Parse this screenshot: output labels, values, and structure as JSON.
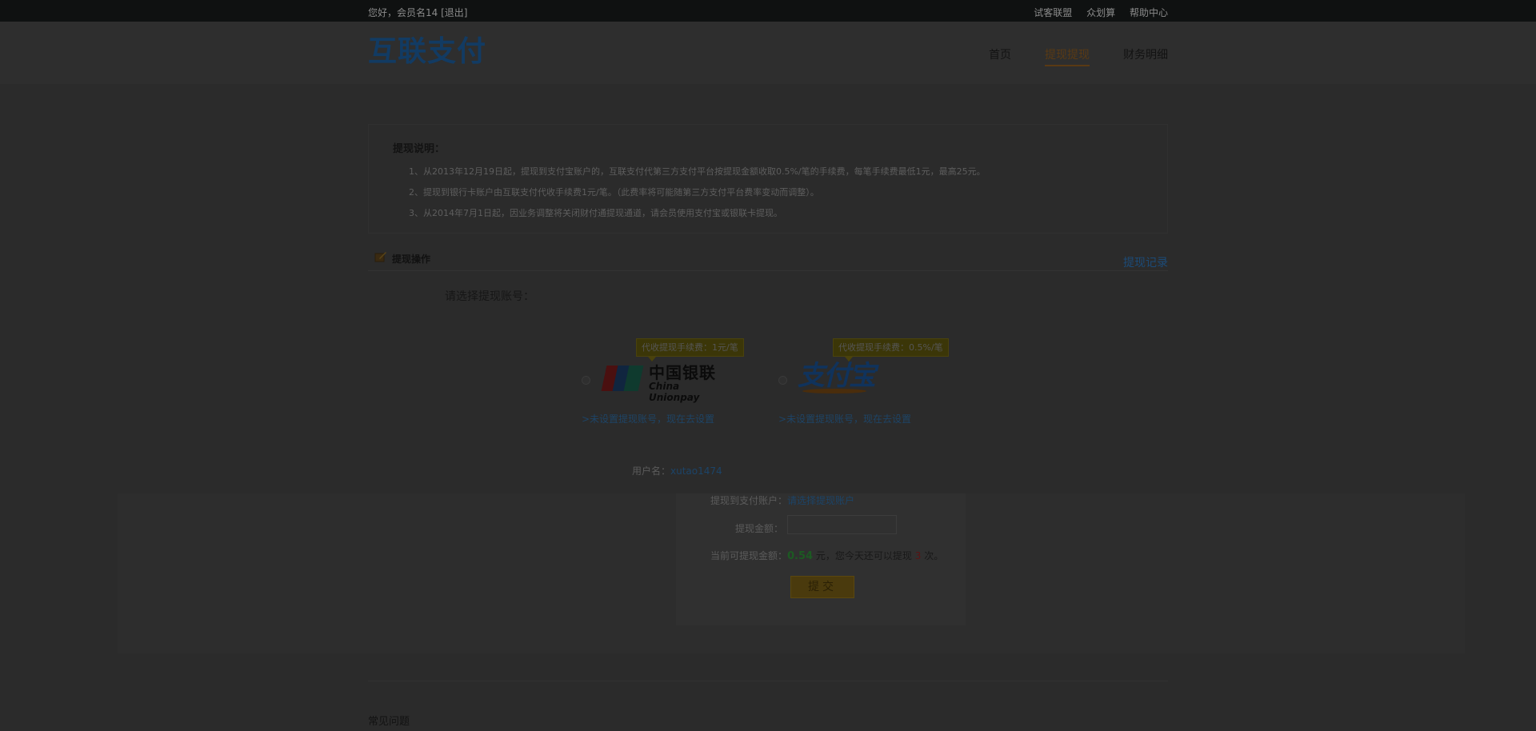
{
  "topbar": {
    "greeting": "您好，会员名14 ",
    "logout": "[退出]",
    "links": [
      "试客联盟",
      "众划算",
      "帮助中心"
    ]
  },
  "header": {
    "logo": "互联支付",
    "nav": {
      "home": "首页",
      "cash": "提现提现",
      "finance": "财务明细"
    }
  },
  "notice": {
    "title": "提现说明：",
    "lines": [
      "1、从2013年12月19日起，提现到支付宝账户的，互联支付代第三方支付平台按提现金额收取0.5%/笔的手续费，每笔手续费最低1元，最高25元。",
      "2、提现到银行卡账户由互联支付代收手续费1元/笔。（此费率将可能随第三方支付平台费率变动而调整）。",
      "3、从2014年7月1日起，因业务调整将关闭财付通提现通道，请会员使用支付宝或银联卡提现。"
    ]
  },
  "section": {
    "title": "提现操作",
    "record_link": "提现记录"
  },
  "choose_label": "请选择提现账号：",
  "options": [
    {
      "tip": "代收提现手续费：1元/笔",
      "logo_cn": "中国银联",
      "logo_en": "China Unionpay",
      "set_link": ">未设置提现账号，现在去设置"
    },
    {
      "tip": "代收提现手续费：0.5%/笔",
      "logo_text": "支付宝",
      "set_link": ">未设置提现账号，现在去设置"
    }
  ],
  "form": {
    "username_label": "用户名：",
    "username": "xutao1474",
    "account_label": "提现到支付账户：",
    "account_value": "请选择提现账户",
    "amount_label": "提现金额：",
    "amount_value": "",
    "balance_label": "当前可提现金额：",
    "balance": "0.54",
    "balance_unit": " 元，您今天还可以提现 ",
    "times": "3",
    "times_unit": " 次。",
    "submit": "提交"
  },
  "faq_title": "常见问题"
}
